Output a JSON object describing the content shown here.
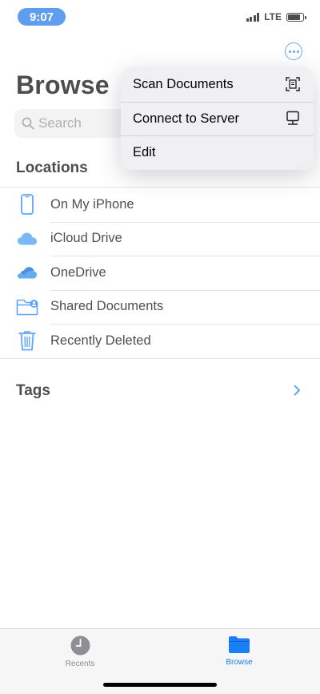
{
  "status_bar": {
    "time": "9:07",
    "network": "LTE"
  },
  "header": {
    "title": "Browse",
    "more_icon": "ellipsis-circle-icon"
  },
  "search": {
    "placeholder": "Search",
    "value": ""
  },
  "locations": {
    "title": "Locations",
    "items": [
      {
        "label": "On My iPhone",
        "icon": "iphone-icon"
      },
      {
        "label": "iCloud Drive",
        "icon": "icloud-icon"
      },
      {
        "label": "OneDrive",
        "icon": "onedrive-icon"
      },
      {
        "label": "Shared Documents",
        "icon": "shared-folder-icon"
      },
      {
        "label": "Recently Deleted",
        "icon": "trash-icon"
      }
    ]
  },
  "tags": {
    "title": "Tags"
  },
  "menu": {
    "items": [
      {
        "label": "Scan Documents",
        "icon": "scan-document-icon"
      },
      {
        "label": "Connect to Server",
        "icon": "server-display-icon"
      },
      {
        "label": "Edit",
        "icon": ""
      }
    ]
  },
  "tab_bar": {
    "tabs": [
      {
        "label": "Recents",
        "icon": "clock-icon",
        "active": false
      },
      {
        "label": "Browse",
        "icon": "folder-icon",
        "active": true
      }
    ]
  },
  "colors": {
    "accent": "#1a7ff7",
    "status_pill": "#1a73e8",
    "search_bg": "#eeeef0"
  }
}
